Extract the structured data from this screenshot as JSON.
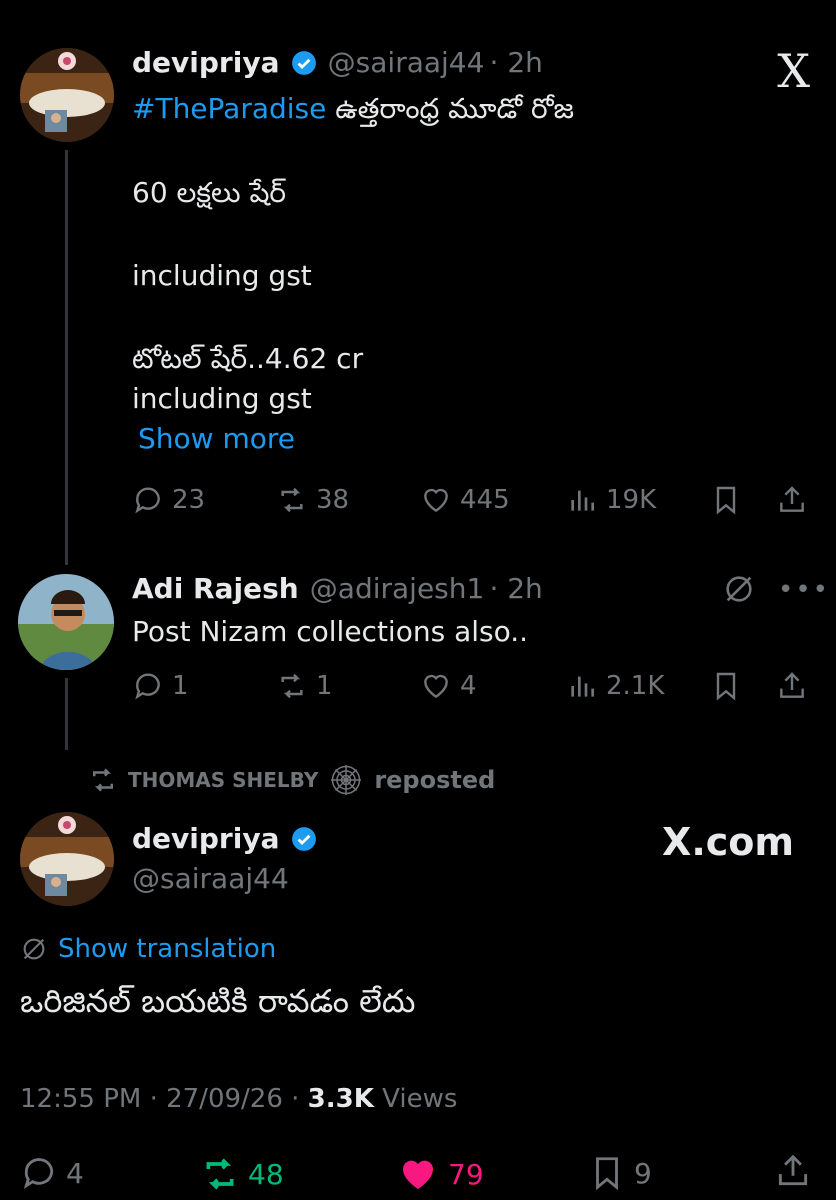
{
  "tweet1": {
    "name": "devipriya",
    "handle": "@sairaaj44",
    "time": "· 2h",
    "hashtag": "#TheParadise",
    "line1_rest": " ఉత్తరాంధ్ర మూడో రోజ",
    "line2": "60 లక్షలు షేర్",
    "line3": "including gst",
    "line4": "టోటల్ షేర్..4.62 cr",
    "line5": "including gst",
    "show_more": "Show more",
    "replies": "23",
    "reposts": "38",
    "likes": "445",
    "views": "19K"
  },
  "reply": {
    "name": "Adi Rajesh",
    "handle": "@adirajesh1",
    "time": "· 2h",
    "text": "Post Nizam collections also..",
    "replies": "1",
    "reposts": "1",
    "likes": "4",
    "views": "2.1K"
  },
  "repost_bar": {
    "user": "THOMAS SHELBY",
    "label": "reposted"
  },
  "main": {
    "name": "devipriya",
    "handle": "@sairaaj44",
    "show_translation": "Show translation",
    "text": "ఒరిజినల్ బయటికి రావడం లేదు",
    "time": "12:55 PM · 27/09/26 · ",
    "views_count": "3.3K",
    "views_label": " Views",
    "replies": "4",
    "reposts": "48",
    "likes": "79",
    "bookmarks": "9"
  },
  "watermark": {
    "top_logo": "X",
    "site": "X.com"
  },
  "colors": {
    "accent": "#1d9bf0",
    "repost_green": "#00ba7c",
    "like_pink": "#f91880",
    "muted": "#71767b"
  }
}
